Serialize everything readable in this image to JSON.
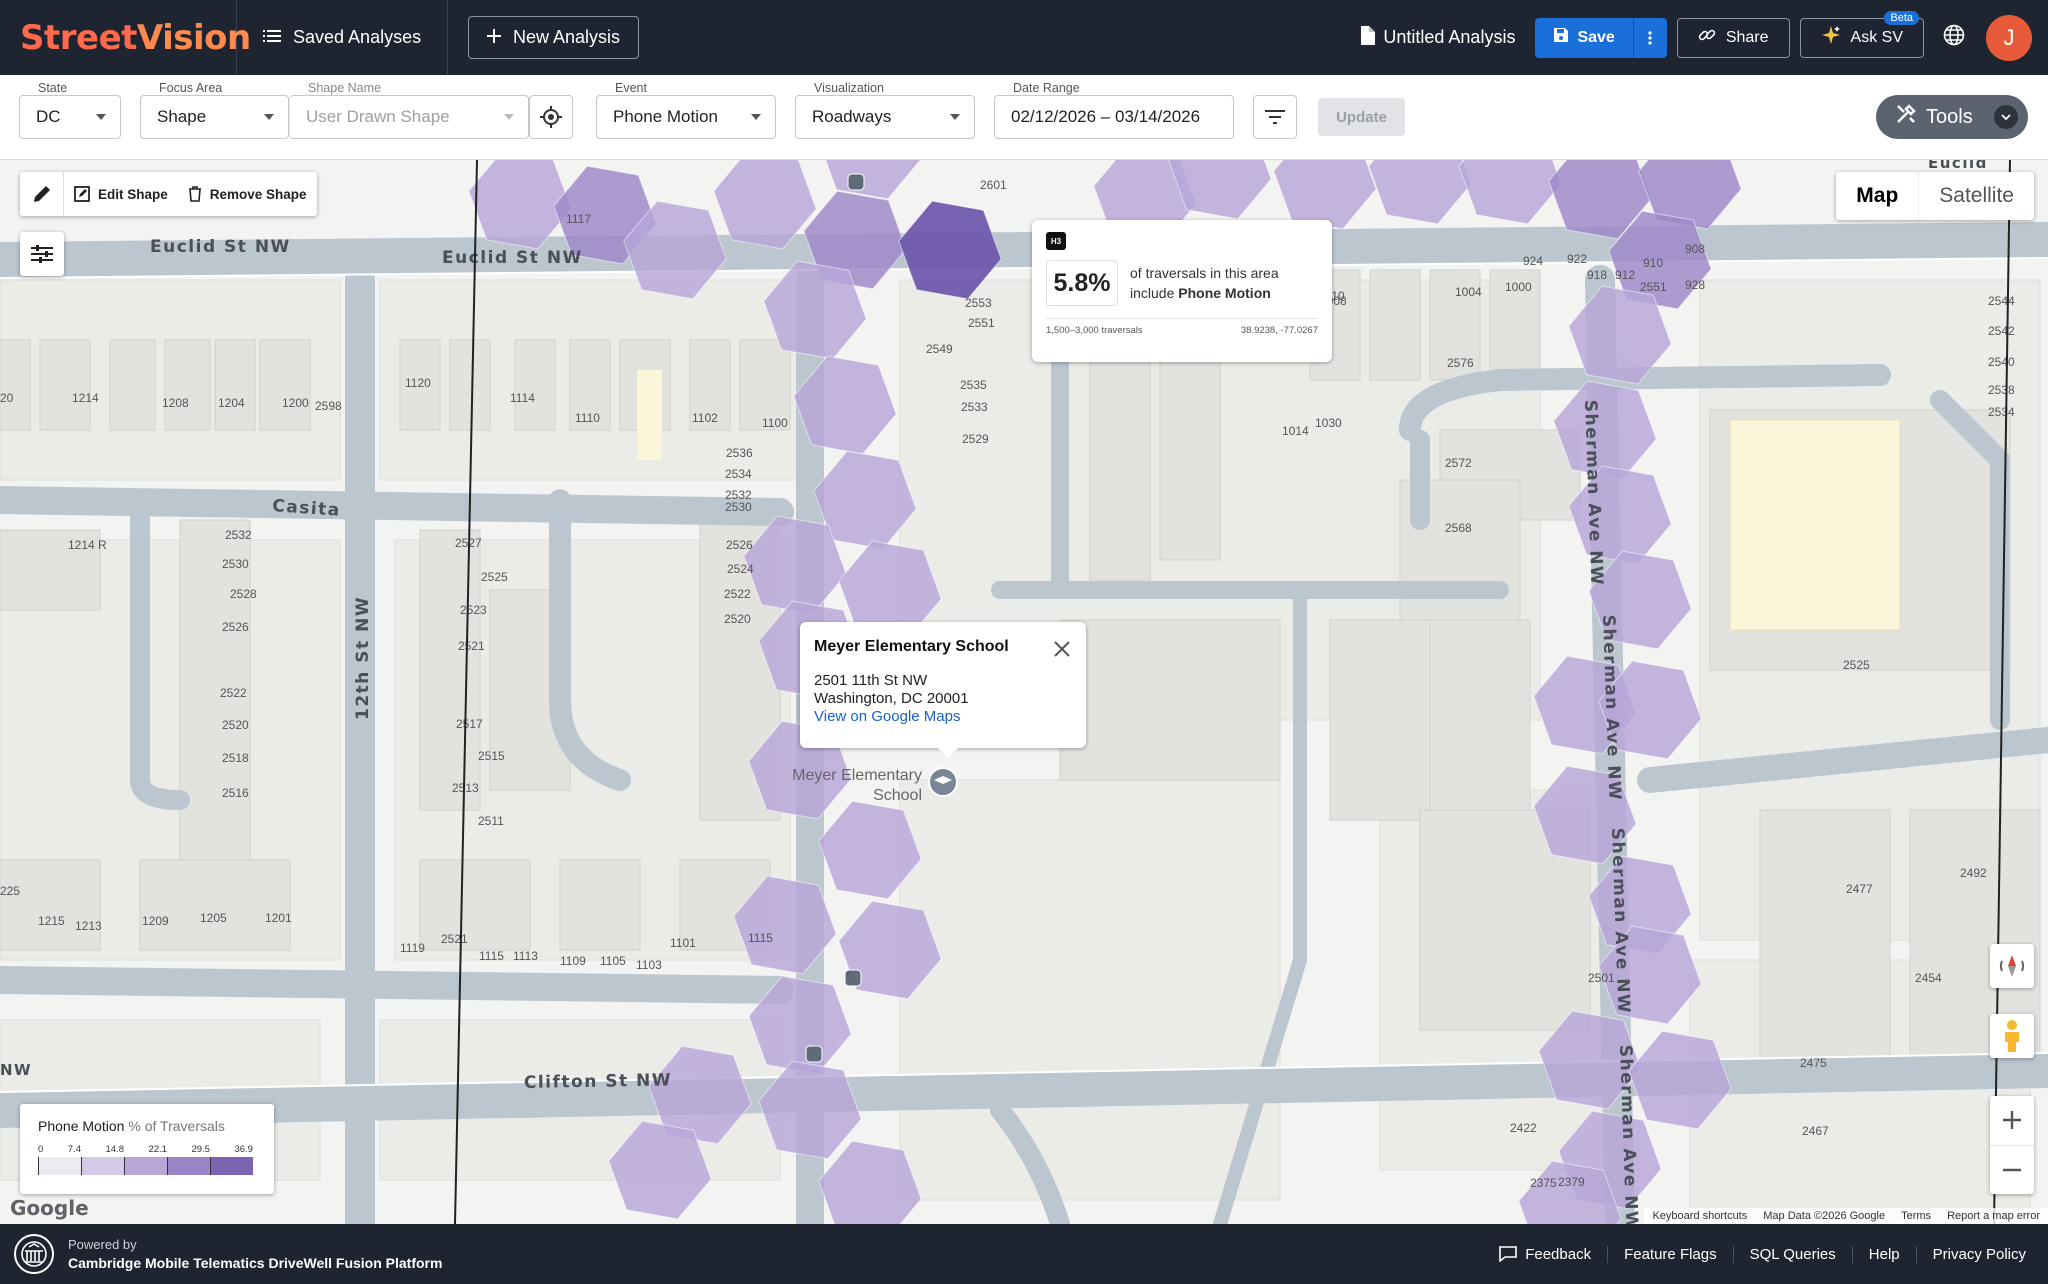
{
  "app": {
    "logo_part1": "Street",
    "logo_part2": "Vision"
  },
  "topbar": {
    "saved_analyses": "Saved Analyses",
    "new_analysis": "New Analysis",
    "analysis_name": "Untitled Analysis",
    "save": "Save",
    "share": "Share",
    "ask": "Ask SV",
    "beta": "Beta",
    "avatar_initial": "J"
  },
  "filters": {
    "state": {
      "label": "State",
      "value": "DC"
    },
    "focus_area": {
      "label": "Focus Area",
      "value": "Shape"
    },
    "shape_name": {
      "label": "Shape Name",
      "value": "User Drawn Shape"
    },
    "event": {
      "label": "Event",
      "value": "Phone Motion"
    },
    "visualization": {
      "label": "Visualization",
      "value": "Roadways"
    },
    "date_range": {
      "label": "Date Range",
      "value": "02/12/2026 – 03/14/2026"
    },
    "update": "Update",
    "tools": "Tools"
  },
  "map": {
    "draw_tools": {
      "edit": "Edit Shape",
      "remove": "Remove Shape"
    },
    "map_type": {
      "map": "Map",
      "satellite": "Satellite"
    },
    "info_card": {
      "tag": "H3",
      "value": "5.8%",
      "desc_line1": "of traversals in this area",
      "desc_prefix": "include ",
      "desc_event": "Phone Motion",
      "traversals": "1,500–3,000 traversals",
      "coords": "38.9238, -77.0267"
    },
    "school_popup": {
      "title": "Meyer Elementary School",
      "address1": "2501 11th St NW",
      "address2": "Washington, DC 20001",
      "link": "View on Google Maps"
    },
    "poi_label_1": "Meyer Elementary",
    "poi_label_2": "School",
    "streets": {
      "euclid1": "Euclid St NW",
      "euclid2": "Euclid St NW",
      "casita": "Casita",
      "twelfth": "12th St NW",
      "clifton": "Clifton St NW",
      "sherman1": "Sherman Ave NW",
      "sherman2": "Sherman Ave NW",
      "sherman3": "Sherman Ave NW",
      "sherman4": "Sherman Ave NW",
      "euclid_r": "Euclid",
      "nw_left": "NW"
    },
    "legend": {
      "title": "Phone Motion",
      "subtitle": "% of Traversals",
      "ticks": [
        "0",
        "7.4",
        "14.8",
        "22.1",
        "29.5",
        "36.9"
      ],
      "colors": [
        "#ecebf1",
        "#d4c9e6",
        "#b7a6d6",
        "#9a84c6",
        "#7c64b0"
      ]
    },
    "google": "Google",
    "attribution": [
      "Keyboard shortcuts",
      "Map Data ©2026 Google",
      "Terms",
      "Report a map error"
    ],
    "house_numbers": [
      "2601",
      "2553",
      "2551",
      "2549",
      "2535",
      "2533",
      "2529",
      "2536",
      "2534",
      "2532",
      "2530",
      "2526",
      "2524",
      "2522",
      "2520",
      "1117",
      "1120",
      "1114",
      "1110",
      "1102",
      "1100",
      "1214",
      "1208",
      "1204",
      "1200",
      "2598",
      "1214 R",
      "20",
      "2532",
      "2530",
      "2528",
      "2526",
      "2522",
      "2520",
      "2518",
      "2516",
      "2527",
      "2525",
      "2523",
      "2521",
      "2517",
      "2515",
      "2513",
      "2511",
      "225",
      "1215",
      "1213",
      "1209",
      "1205",
      "1201",
      "1119",
      "2521",
      "1115",
      "1113",
      "1109",
      "1105",
      "1103",
      "1101",
      "1115",
      "1030",
      "1014",
      "1010",
      "1008",
      "1004",
      "1000",
      "2576",
      "2572",
      "2568",
      "924",
      "922",
      "918",
      "912",
      "910",
      "908",
      "928",
      "2551",
      "2544",
      "2542",
      "2540",
      "2538",
      "2534",
      "2525",
      "2492",
      "2477",
      "2454",
      "2475",
      "2467",
      "2501",
      "2422",
      "2379",
      "2375"
    ]
  },
  "footer": {
    "powered": "Powered by",
    "platform": "Cambridge Mobile Telematics DriveWell Fusion Platform",
    "links": [
      "Feedback",
      "Feature Flags",
      "SQL Queries",
      "Help",
      "Privacy Policy"
    ]
  },
  "colors": {
    "header_bg": "#1e2530",
    "accent": "#1a6fd8",
    "hex_light": "#b8a8d8",
    "hex_mid": "#9580c5",
    "hex_dark": "#6a55a8"
  }
}
